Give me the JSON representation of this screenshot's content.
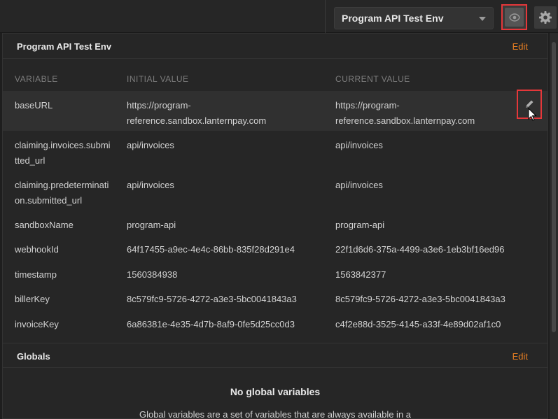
{
  "topbar": {
    "environment_selected": "Program API Test Env"
  },
  "environment": {
    "title": "Program API Test Env",
    "edit_label": "Edit",
    "columns": {
      "variable": "VARIABLE",
      "initial": "INITIAL VALUE",
      "current": "CURRENT VALUE"
    },
    "rows": [
      {
        "variable": "baseURL",
        "initial": "https://program-reference.sandbox.lanternpay.com",
        "current": "https://program-reference.sandbox.lanternpay.com"
      },
      {
        "variable": "claiming.invoices.submitted_url",
        "initial": "api/invoices",
        "current": "api/invoices"
      },
      {
        "variable": "claiming.predetermination.submitted_url",
        "initial": "api/invoices",
        "current": "api/invoices"
      },
      {
        "variable": "sandboxName",
        "initial": "program-api",
        "current": "program-api"
      },
      {
        "variable": "webhookId",
        "initial": "64f17455-a9ec-4e4c-86bb-835f28d291e4",
        "current": "22f1d6d6-375a-4499-a3e6-1eb3bf16ed96"
      },
      {
        "variable": "timestamp",
        "initial": "1560384938",
        "current": "1563842377"
      },
      {
        "variable": "billerKey",
        "initial": "8c579fc9-5726-4272-a3e3-5bc0041843a3",
        "current": "8c579fc9-5726-4272-a3e3-5bc0041843a3"
      },
      {
        "variable": "invoiceKey",
        "initial": "6a86381e-4e35-4d7b-8af9-0fe5d25cc0d3",
        "current": "c4f2e88d-3525-4145-a33f-4e89d02af1c0"
      }
    ]
  },
  "globals": {
    "title": "Globals",
    "edit_label": "Edit",
    "empty_title": "No global variables",
    "empty_desc": "Global variables are a set of variables that are always available in a"
  },
  "icons": {
    "eye": "eye-icon",
    "gear": "gear-icon",
    "pencil": "pencil-icon",
    "caret": "caret-down-icon"
  },
  "colors": {
    "accent": "#e67e22",
    "highlight": "#e5373a"
  }
}
